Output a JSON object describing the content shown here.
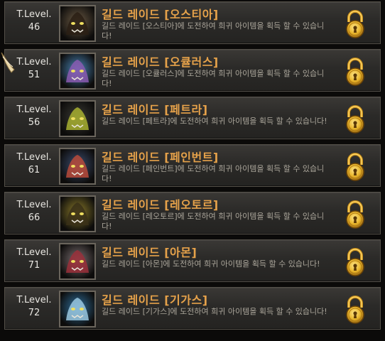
{
  "raids": [
    {
      "level_label": "T.Level.",
      "level": "46",
      "title": "길드 레이드 [오스티아]",
      "desc": "길드 레이드 [오스티아]에 도전하여 희귀 아이템을 획득 할 수 있습니다!",
      "portrait_color": "#6b5a44",
      "portrait_accent": "#2a1e14"
    },
    {
      "level_label": "T.Level.",
      "level": "51",
      "title": "길드 레이드 [오큘러스]",
      "desc": "길드 레이드 [오큘러스]에 도전하여 희귀 아이템을 획득 할 수 있습니다!",
      "portrait_color": "#4a86b8",
      "portrait_accent": "#8a5bb0"
    },
    {
      "level_label": "T.Level.",
      "level": "56",
      "title": "길드 레이드 [페트라]",
      "desc": "길드 레이드 [페트라]에 도전하여 희귀 아이템을 획득 할 수 있습니다!",
      "portrait_color": "#3a3a34",
      "portrait_accent": "#a8b030"
    },
    {
      "level_label": "T.Level.",
      "level": "61",
      "title": "길드 레이드 [페인번트]",
      "desc": "길드 레이드 [페인번트]에 도전하여 희귀 아이템을 획득 할 수 있습니다!",
      "portrait_color": "#3b4c6e",
      "portrait_accent": "#b84a3a"
    },
    {
      "level_label": "T.Level.",
      "level": "66",
      "title": "길드 레이드 [레오토르]",
      "desc": "길드 레이드 [레오토르]에 도전하여 희귀 아이템을 획득 할 수 있습니다!",
      "portrait_color": "#8a7a2a",
      "portrait_accent": "#3a3018"
    },
    {
      "level_label": "T.Level.",
      "level": "71",
      "title": "길드 레이드 [아몬]",
      "desc": "길드 레이드 [아몬]에 도전하여 희귀 아이템을 획득 할 수 있습니다!",
      "portrait_color": "#7a6e70",
      "portrait_accent": "#9a2f3a"
    },
    {
      "level_label": "T.Level.",
      "level": "72",
      "title": "길드 레이드 [기가스]",
      "desc": "길드 레이드 [기가스]에 도전하여 희귀 아이템을 획득 할 수 있습니다!",
      "portrait_color": "#2f6e9a",
      "portrait_accent": "#9ac8e0"
    }
  ],
  "icons": {
    "lock": "lock-icon",
    "cursor": "hand-cursor-icon"
  },
  "colors": {
    "title": "#e6a24a",
    "desc": "#aaa59a",
    "level": "#e8e6e1",
    "lock_gold": "#e8b42a"
  }
}
